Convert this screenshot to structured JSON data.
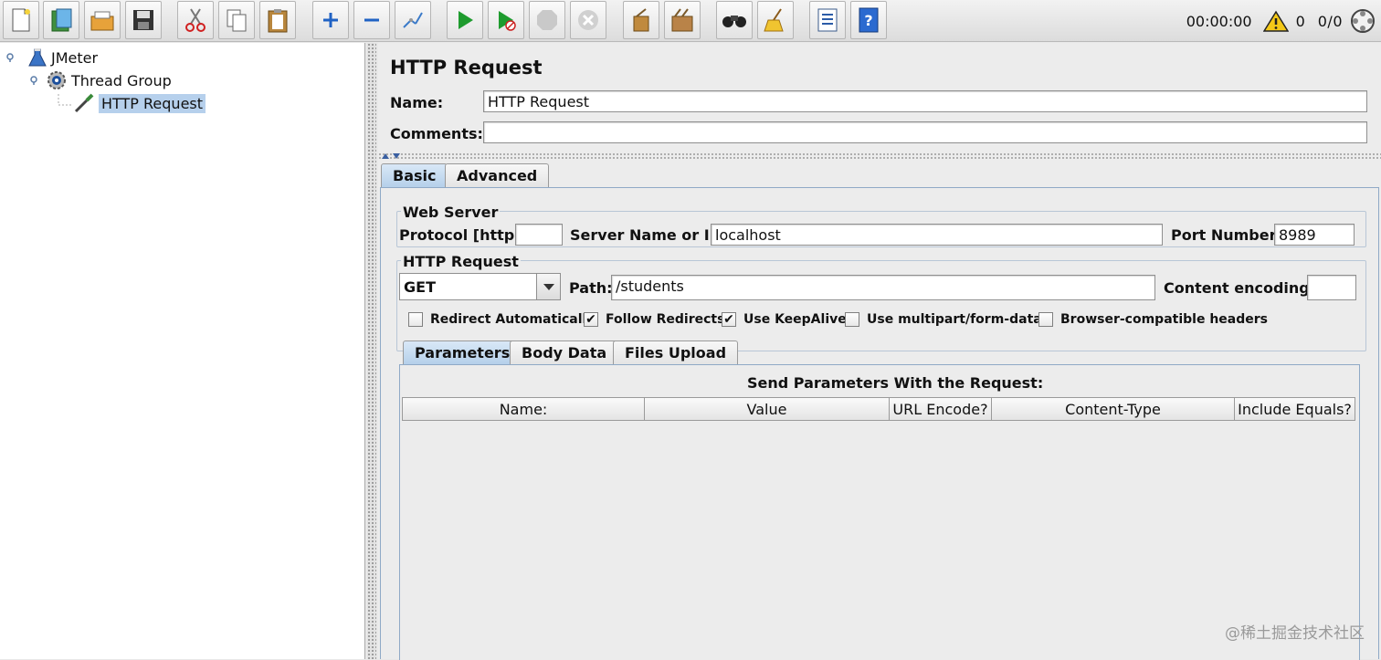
{
  "toolbar": {
    "buttons": [
      {
        "name": "new-icon"
      },
      {
        "name": "templates-icon"
      },
      {
        "name": "open-icon"
      },
      {
        "name": "save-icon"
      },
      {
        "name": "cut-icon"
      },
      {
        "name": "copy-icon"
      },
      {
        "name": "paste-icon"
      },
      {
        "name": "expand-icon"
      },
      {
        "name": "collapse-icon"
      },
      {
        "name": "toggle-icon"
      },
      {
        "name": "start-icon"
      },
      {
        "name": "start-no-pause-icon"
      },
      {
        "name": "stop-icon"
      },
      {
        "name": "shutdown-icon"
      },
      {
        "name": "clear-icon"
      },
      {
        "name": "clear-all-icon"
      },
      {
        "name": "search-icon"
      },
      {
        "name": "reset-search-icon"
      },
      {
        "name": "function-helper-icon"
      },
      {
        "name": "help-icon"
      }
    ],
    "timer": "00:00:00",
    "warning_count": "0",
    "threads": "0/0"
  },
  "tree": {
    "items": [
      {
        "label": "JMeter",
        "icon": "flask-icon"
      },
      {
        "label": "Thread Group",
        "icon": "gear-icon"
      },
      {
        "label": "HTTP Request",
        "icon": "pipette-icon",
        "selected": true
      }
    ]
  },
  "panel": {
    "title": "HTTP Request",
    "name_label": "Name:",
    "name_value": "HTTP Request",
    "comments_label": "Comments:",
    "comments_value": "",
    "tabs": [
      {
        "label": "Basic",
        "active": true
      },
      {
        "label": "Advanced",
        "active": false
      }
    ],
    "web_server": {
      "legend": "Web Server",
      "protocol_label": "Protocol [http]:",
      "protocol_value": "",
      "server_label": "Server Name or IP:",
      "server_value": "localhost",
      "port_label": "Port Number:",
      "port_value": "8989"
    },
    "http_request": {
      "legend": "HTTP Request",
      "method": "GET",
      "path_label": "Path:",
      "path_value": "/students",
      "encoding_label": "Content encoding:",
      "encoding_value": ""
    },
    "checkboxes": [
      {
        "label": "Redirect Automatically",
        "checked": false
      },
      {
        "label": "Follow Redirects",
        "checked": true
      },
      {
        "label": "Use KeepAlive",
        "checked": true
      },
      {
        "label": "Use multipart/form-data",
        "checked": false
      },
      {
        "label": "Browser-compatible headers",
        "checked": false
      }
    ],
    "sub_tabs": [
      {
        "label": "Parameters",
        "active": true
      },
      {
        "label": "Body Data",
        "active": false
      },
      {
        "label": "Files Upload",
        "active": false
      }
    ],
    "params_title": "Send Parameters With the Request:",
    "columns": [
      "Name:",
      "Value",
      "URL Encode?",
      "Content-Type",
      "Include Equals?"
    ]
  },
  "watermark": "@稀土掘金技术社区"
}
